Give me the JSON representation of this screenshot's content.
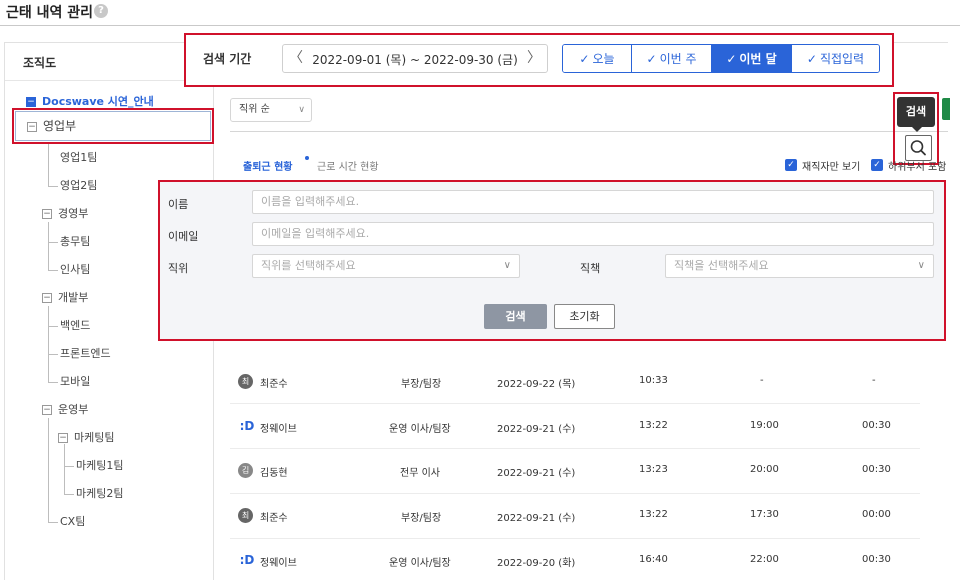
{
  "page": {
    "title": "근태 내역 관리",
    "help_icon": "?"
  },
  "sidebar": {
    "title": "조직도",
    "root": {
      "toggle": "−",
      "label": "Docswave 시연_안내"
    },
    "items": [
      {
        "label": "영업부",
        "toggle": "−"
      },
      {
        "label": "영업1팀"
      },
      {
        "label": "영업2팀"
      },
      {
        "label": "경영부",
        "toggle": "−"
      },
      {
        "label": "총무팀"
      },
      {
        "label": "인사팀"
      },
      {
        "label": "개발부",
        "toggle": "−"
      },
      {
        "label": "백엔드"
      },
      {
        "label": "프론트엔드"
      },
      {
        "label": "모바일"
      },
      {
        "label": "운영부",
        "toggle": "−"
      },
      {
        "label": "마케팅팀",
        "toggle": "−"
      },
      {
        "label": "마케팅1팀"
      },
      {
        "label": "마케팅2팀"
      },
      {
        "label": "CX팀"
      }
    ]
  },
  "toolbar": {
    "date_label": "검색 기간",
    "date_prev": "〈",
    "date_next": "〉",
    "date_range": "2022-09-01 (목) ~ 2022-09-30 (금)",
    "periods": [
      {
        "label": "오늘",
        "check": "✓"
      },
      {
        "label": "이번 주",
        "check": "✓"
      },
      {
        "label": "이번 달",
        "check": "✓"
      },
      {
        "label": "직접입력",
        "check": "✓"
      }
    ],
    "sort_label": "직위 순",
    "sort_caret": "∨",
    "search_tooltip": "검색"
  },
  "tabs": {
    "attendance": "출퇴근 현황",
    "worktime": "근로 시간 현황",
    "employed_only": "재직자만 보기",
    "include_sub": "하위부서 포함",
    "check": "✓"
  },
  "search_panel": {
    "name_label": "이름",
    "name_placeholder": "이름을 입력해주세요.",
    "email_label": "이메일",
    "email_placeholder": "이메일을 입력해주세요.",
    "position_label": "직위",
    "position_placeholder": "직위를 선택해주세요",
    "role_label": "직책",
    "role_placeholder": "직책을 선택해주세요",
    "caret": "∨",
    "search_button": "검색",
    "reset_button": "초기화"
  },
  "rows": [
    {
      "avatar": "최",
      "name": "최준수",
      "position": "부장/팀장",
      "date": "2022-09-22 (목)",
      "in": "10:33",
      "out": "-",
      "extra": "-"
    },
    {
      "avatar": ":D",
      "name": "정웨이브",
      "position": "운영 이사/팀장",
      "date": "2022-09-21 (수)",
      "in": "13:22",
      "out": "19:00",
      "extra": "00:30"
    },
    {
      "avatar": "김",
      "name": "김동현",
      "position": "전무 이사",
      "date": "2022-09-21 (수)",
      "in": "13:23",
      "out": "20:00",
      "extra": "00:30"
    },
    {
      "avatar": "최",
      "name": "최준수",
      "position": "부장/팀장",
      "date": "2022-09-21 (수)",
      "in": "13:22",
      "out": "17:30",
      "extra": "00:00"
    },
    {
      "avatar": ":D",
      "name": "정웨이브",
      "position": "운영 이사/팀장",
      "date": "2022-09-20 (화)",
      "in": "16:40",
      "out": "22:00",
      "extra": "00:30"
    }
  ]
}
